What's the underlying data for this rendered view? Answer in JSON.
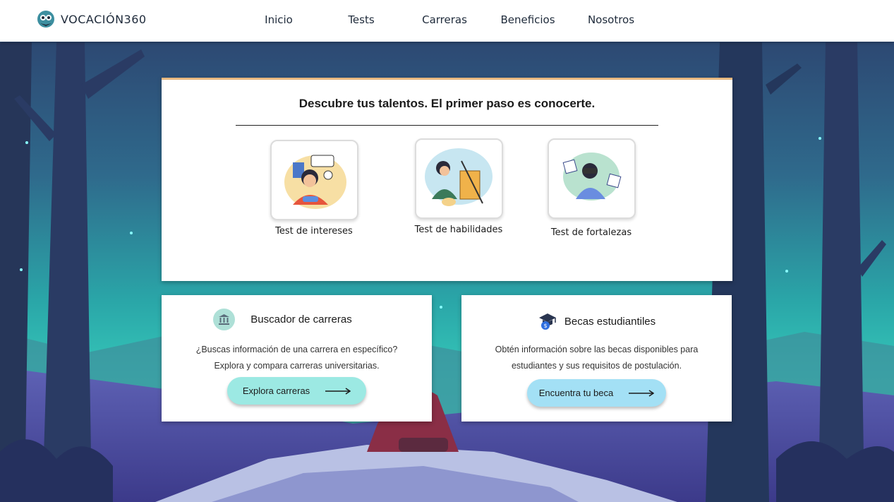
{
  "brand": {
    "name": "VOCACIÓN360"
  },
  "nav": [
    {
      "label": "Inicio"
    },
    {
      "label": "Tests"
    },
    {
      "label": "Carreras"
    },
    {
      "label": "Beneficios"
    },
    {
      "label": "Nosotros"
    }
  ],
  "hero": {
    "title": "Descubre tus talentos. El primer paso es conocerte.",
    "tests": [
      {
        "label": "Test de intereses",
        "icon": "interests-illustration"
      },
      {
        "label": "Test de habilidades",
        "icon": "skills-illustration"
      },
      {
        "label": "Test de fortalezas",
        "icon": "strengths-illustration"
      }
    ]
  },
  "careers": {
    "title": "Buscador de carreras",
    "line1": "¿Buscas información de una carrera en específico?",
    "line2": "Explora y compara carreras universitarias.",
    "button": "Explora carreras",
    "icon": "university-icon",
    "button_color": "#9ce9e3"
  },
  "scholarships": {
    "title": "Becas estudiantiles",
    "line1": "Obtén información sobre las becas disponibles para",
    "line2": "estudiantes y sus requisitos de postulación.",
    "button": "Encuentra tu beca",
    "icon": "graduation-cap-icon",
    "button_color": "#a3e0f5"
  },
  "colors": {
    "accent": "#e7b87f",
    "header_bg": "#ffffff"
  }
}
